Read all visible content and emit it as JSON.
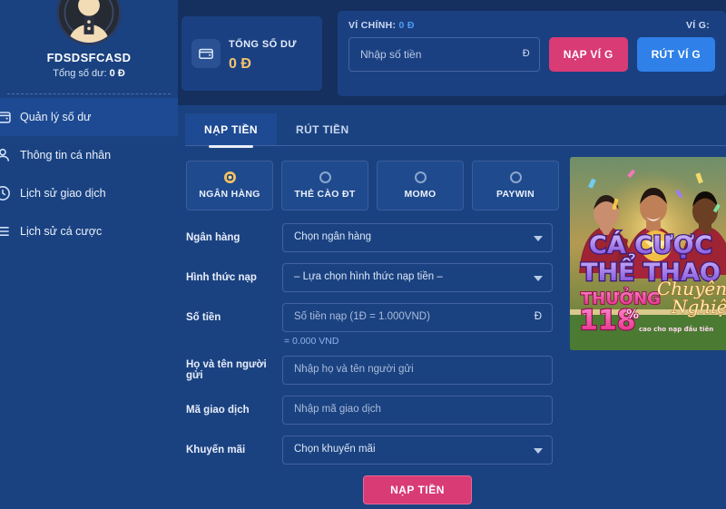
{
  "sidebar": {
    "profile": {
      "avatar_icon": "user-avatar-icon",
      "name": "FDSDSFCASD",
      "balance_label": "Tổng số dư:",
      "balance_value": "0 Đ"
    },
    "items": [
      {
        "label": "Quản lý số dư",
        "icon": "wallet-icon",
        "active": true
      },
      {
        "label": "Thông tin cá nhân",
        "icon": "user-icon",
        "active": false
      },
      {
        "label": "Lịch sử giao dịch",
        "icon": "clock-icon",
        "active": false
      },
      {
        "label": "Lịch sử cá cược",
        "icon": "list-icon",
        "active": false
      }
    ]
  },
  "topbar": {
    "balance_card": {
      "icon": "wallet-icon",
      "label": "TỔNG SỐ DƯ",
      "value": "0 Đ"
    },
    "wallet_card": {
      "main_wallet_label": "VÍ CHÍNH:",
      "main_wallet_value": "0 Đ",
      "g_wallet_label": "VÍ G:",
      "amount_placeholder": "Nhập số tiền",
      "amount_value": "",
      "currency_suffix": "Đ",
      "deposit_g_button": "NẠP VÍ G",
      "withdraw_g_button": "RÚT VÍ G"
    }
  },
  "main": {
    "tabs": [
      {
        "label": "NẠP TIỀN",
        "active": true
      },
      {
        "label": "RÚT TIỀN",
        "active": false
      }
    ],
    "methods": [
      {
        "label": "NGÂN HÀNG",
        "selected": true
      },
      {
        "label": "THẺ CÀO ĐT",
        "selected": false
      },
      {
        "label": "MOMO",
        "selected": false
      },
      {
        "label": "PAYWIN",
        "selected": false
      }
    ],
    "form": {
      "bank": {
        "label": "Ngân hàng",
        "value": "Chọn ngân hàng",
        "type": "select"
      },
      "deposit_type": {
        "label": "Hình thức nạp",
        "value": "– Lựa chọn hình thức nạp tiền –",
        "type": "select"
      },
      "amount": {
        "label": "Số tiền",
        "placeholder": "Số tiền nạp (1Đ = 1.000VND)",
        "unit": "Đ",
        "hint": "= 0.000 VND"
      },
      "sender_name": {
        "label": "Họ và tên người gửi",
        "placeholder": "Nhập họ và tên người gửi"
      },
      "transaction_code": {
        "label": "Mã giao dịch",
        "placeholder": "Nhập mã giao dịch"
      },
      "promotion": {
        "label": "Khuyến mãi",
        "value": "Chọn khuyến mãi",
        "type": "select"
      },
      "submit_label": "NẠP TIỀN"
    }
  },
  "banner": {
    "line1": "CÁ CƯỢC",
    "line2": "THỂ THAO",
    "line3": "THƯỞNG",
    "script1": "Chuyên",
    "script2": "Nghiệp",
    "percent": "118",
    "percent_sign": "%",
    "subtext": "cao cho nạp đầu tiên"
  },
  "colors": {
    "page_bg": "#15305f",
    "panel_bg": "#1b4280",
    "sidebar_bg": "#1a4281",
    "accent_pink": "#d93b74",
    "accent_blue": "#2f80e8",
    "gold": "#f3c46a",
    "link_blue": "#4f9cf5"
  }
}
